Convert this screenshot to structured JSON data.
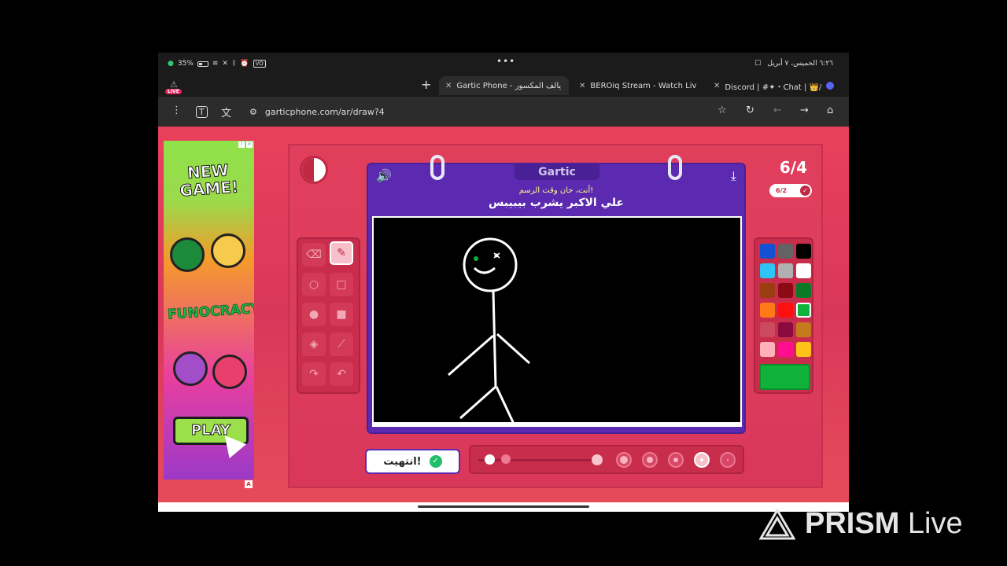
{
  "status_bar": {
    "battery": "35%",
    "vol_label": "VO",
    "right_text": "٦:٢٦ الخميس، ٧ أبريل",
    "menu_dots": "•••"
  },
  "live_badge": "LIVE",
  "tabs": [
    {
      "label": "Gartic Phone - يالف المكسور",
      "active": true
    },
    {
      "label": "BEROiq Stream - Watch Liv",
      "active": false
    },
    {
      "label": "Discord | #✦・Chat | 👑/",
      "active": false
    }
  ],
  "url": "garticphone.com/ar/draw?4",
  "ad": {
    "title": "NEW GAME!",
    "logo": "FUNOCRACY",
    "play": "PLAY",
    "mark": "A"
  },
  "game": {
    "brand": "Gartic",
    "prompt_sub": "أنت، حان وقت الرسم!",
    "prompt": "علي الاكبر يشرب بيبيبس",
    "round": "6/4",
    "round_badge": "6/2",
    "done_label": "انتهيت!",
    "progress_fraction": 0.5
  },
  "palette": {
    "colors": [
      "#1450d2",
      "#636363",
      "#000000",
      "#2ec4f5",
      "#b0b0b0",
      "#ffffff",
      "#9a3d10",
      "#8b0a13",
      "#0b7a27",
      "#ff7a17",
      "#ff1010",
      "#10b33a",
      "#cc4a5e",
      "#8b0a3f",
      "#c37b1e",
      "#ffb0b8",
      "#ff0f8f",
      "#ffc21a"
    ],
    "selected_index": 11,
    "current": "#10b33a"
  },
  "watermark": {
    "brand": "PRISM",
    "suffix": "Live"
  }
}
